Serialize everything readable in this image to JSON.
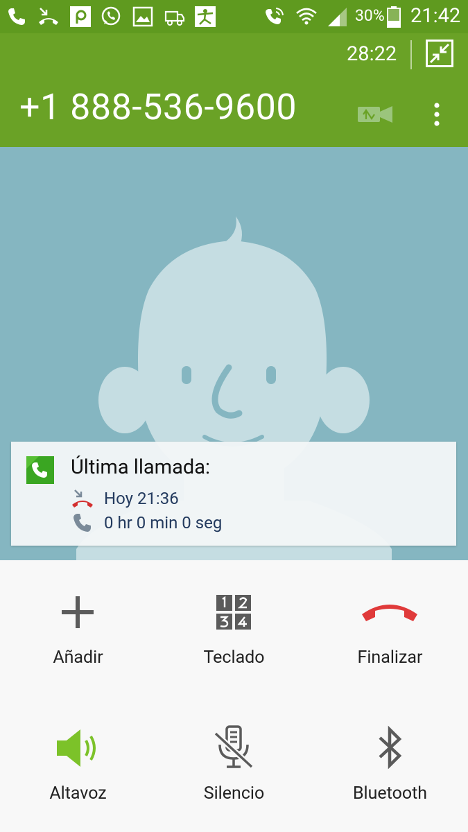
{
  "status_bar": {
    "icons": [
      "phone-icon",
      "missed-call-icon",
      "p-app-icon",
      "whatsapp-icon",
      "gallery-icon",
      "truck-icon",
      "fitness-app-icon",
      "wifi-calling-icon",
      "wifi-icon",
      "signal-icon",
      "battery-icon"
    ],
    "battery": "30%",
    "clock": "21:42"
  },
  "call": {
    "timer": "28:22",
    "number": "+1 888-536-9600"
  },
  "last_call": {
    "title": "Última llamada:",
    "time": "Hoy 21:36",
    "duration": "0 hr 0 min 0 seg"
  },
  "actions": [
    {
      "label": "Añadir",
      "icon": "plus-icon"
    },
    {
      "label": "Teclado",
      "icon": "keypad-icon"
    },
    {
      "label": "Finalizar",
      "icon": "end-call-icon"
    },
    {
      "label": "Altavoz",
      "icon": "speaker-icon"
    },
    {
      "label": "Silencio",
      "icon": "mute-mic-icon"
    },
    {
      "label": "Bluetooth",
      "icon": "bluetooth-icon"
    }
  ],
  "colors": {
    "status_bar": "#5f9a1f",
    "header": "#6aa226",
    "contact_bg": "#85b6c1",
    "speaker_green": "#7cc229",
    "end_red": "#e03a3a"
  }
}
